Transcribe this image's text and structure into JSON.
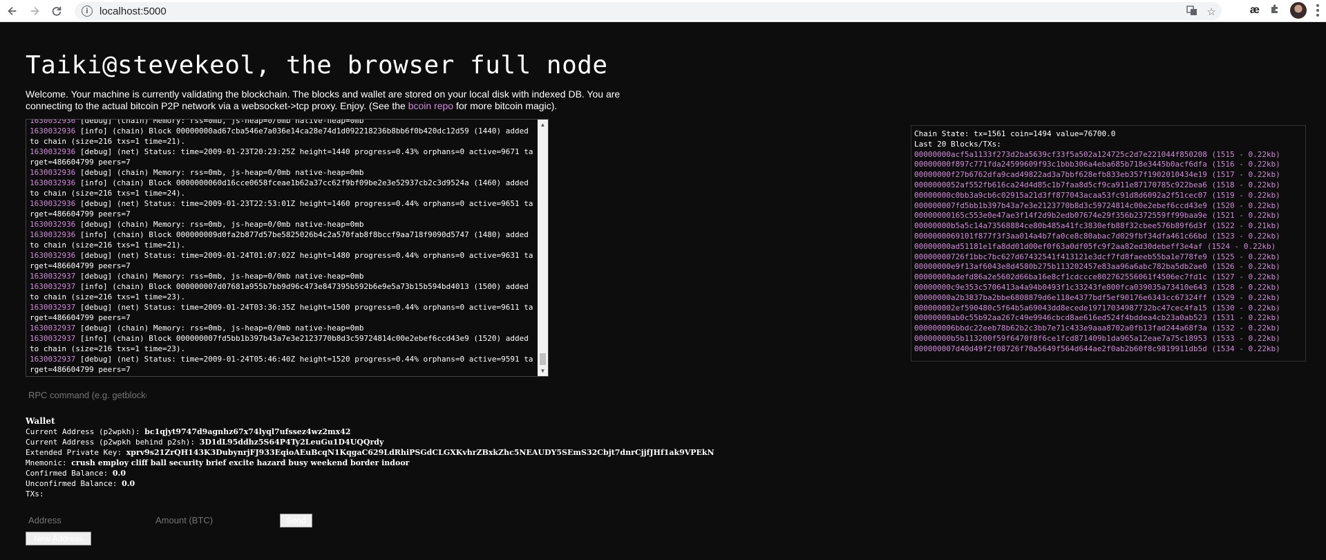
{
  "browser": {
    "url": "localhost:5000",
    "ext_label": "æ"
  },
  "page": {
    "title": "Taiki@stevekeol, the browser full node",
    "intro_before": "Welcome. Your machine is currently validating the blockchain. The blocks and wallet are stored on your local disk with indexed DB. You are connecting to the actual bitcoin P2P network via a websocket->tcp proxy. Enjoy. (See the ",
    "intro_link": "bcoin repo",
    "intro_after": " for more bitcoin magic)."
  },
  "log": [
    {
      "ts": "1630032936",
      "msg": " [debug] (chain) Memory: rss=0mb, js-heap=0/0mb native-heap=0mb"
    },
    {
      "ts": "1630032936",
      "msg": " [info] (chain) Block 00000000ad67cba546e7a036e14ca28e74d1d092218236b8bb6f0b420dc12d59 (1440) added to chain (size=216 txs=1 time=21)."
    },
    {
      "ts": "1630032936",
      "msg": " [debug] (net) Status: time=2009-01-23T20:23:25Z height=1440 progress=0.43% orphans=0 active=9671 target=486604799 peers=7"
    },
    {
      "ts": "1630032936",
      "msg": " [debug] (chain) Memory: rss=0mb, js-heap=0/0mb native-heap=0mb"
    },
    {
      "ts": "1630032936",
      "msg": " [info] (chain) Block 0000000060d16cce0658fceae1b62a37cc62f9bf09be2e3e52937cb2c3d9524a (1460) added to chain (size=216 txs=1 time=24)."
    },
    {
      "ts": "1630032936",
      "msg": " [debug] (net) Status: time=2009-01-23T22:53:01Z height=1460 progress=0.44% orphans=0 active=9651 target=486604799 peers=7"
    },
    {
      "ts": "1630032936",
      "msg": " [debug] (chain) Memory: rss=0mb, js-heap=0/0mb native-heap=0mb"
    },
    {
      "ts": "1630032936",
      "msg": " [info] (chain) Block 000000009d0fa2b877d57be5825026b4c2a570fab8f8bccf9aa718f9090d5747 (1480) added to chain (size=216 txs=1 time=21)."
    },
    {
      "ts": "1630032936",
      "msg": " [debug] (net) Status: time=2009-01-24T01:07:02Z height=1480 progress=0.44% orphans=0 active=9631 target=486604799 peers=7"
    },
    {
      "ts": "1630032937",
      "msg": " [debug] (chain) Memory: rss=0mb, js-heap=0/0mb native-heap=0mb"
    },
    {
      "ts": "1630032937",
      "msg": " [info] (chain) Block 000000007d07681a955b7bb9d96c473e847395b592b6e9e5a73b15b594bd4013 (1500) added to chain (size=216 txs=1 time=23)."
    },
    {
      "ts": "1630032937",
      "msg": " [debug] (net) Status: time=2009-01-24T03:36:35Z height=1500 progress=0.44% orphans=0 active=9611 target=486604799 peers=7"
    },
    {
      "ts": "1630032937",
      "msg": " [debug] (chain) Memory: rss=0mb, js-heap=0/0mb native-heap=0mb"
    },
    {
      "ts": "1630032937",
      "msg": " [info] (chain) Block 000000007fd5bb1b397b43a7e3e2123770b8d3c59724814c00e2ebef6ccd43e9 (1520) added to chain (size=216 txs=1 time=23)."
    },
    {
      "ts": "1630032937",
      "msg": " [debug] (net) Status: time=2009-01-24T05:46:40Z height=1520 progress=0.44% orphans=0 active=9591 target=486604799 peers=7"
    }
  ],
  "rpc": {
    "placeholder": "RPC command (e.g. getblockchaininfo)"
  },
  "wallet": {
    "title": "Wallet",
    "p2wpkh_label": "Current Address (p2wpkh): ",
    "p2wpkh": "bc1qjyt9747d9agnhz67x74lyql7ufssez4wz2mx42",
    "p2sh_label": "Current Address (p2wpkh behind p2sh): ",
    "p2sh": "3D1dL95ddhz5S64P4Ty2LeuGu1D4UQQrdy",
    "xpriv_label": "Extended Private Key: ",
    "xpriv": "xprv9s21ZrQH143K3DubynrjFJ933EqioAEuBcqN1KqgaC629LdRhiPSGdCLGXKvhrZBxkZhc5NEAUDY5SEmS32Cbjt7dnrCjjfJHf1ak9VPEkN",
    "mnemonic_label": "Mnemonic: ",
    "mnemonic": "crush employ cliff ball security brief excite hazard busy weekend border indoor",
    "confirmed_label": "Confirmed Balance: ",
    "confirmed": "0.0",
    "unconfirmed_label": "Unconfirmed Balance: ",
    "unconfirmed": "0.0",
    "txs_label": "TXs:"
  },
  "send": {
    "address_placeholder": "Address",
    "amount_placeholder": "Amount (BTC)",
    "send_label": "Send",
    "new_address_label": "New Address"
  },
  "chain": {
    "state": "Chain State: tx=1561 coin=1494 value=76700.0",
    "last_label": "Last 20 Blocks/TXs:",
    "blocks": [
      {
        "hash": "00000000acf5a1133f273d2ba5639cf33f5a502a124725c2d7e221044f850208",
        "info": " (1515 - 0.22kb)"
      },
      {
        "hash": "00000000f897c771fda24599609f93c1bbb306a4eba685b718e3445b0acf6dfa",
        "info": " (1516 - 0.22kb)"
      },
      {
        "hash": "00000000f27b6762dfa9cad49822ad3a7bbf628efb833eb357f1902010434e19",
        "info": " (1517 - 0.22kb)"
      },
      {
        "hash": "0000000052af552fb616ca24d4d85c1b7faa8d5cf9ca911e87170785c922bea6",
        "info": " (1518 - 0.22kb)"
      },
      {
        "hash": "00000000c0bb3a9cb6c02915a21d3ff877043acaa53fc91d8d6092a2f51cec07",
        "info": " (1519 - 0.22kb)"
      },
      {
        "hash": "000000007fd5bb1b397b43a7e3e2123770b8d3c59724814c00e2ebef6ccd43e9",
        "info": " (1520 - 0.22kb)"
      },
      {
        "hash": "00000000165c553e0e47ae3f14f2d9b2edb07674e29f356b2372559ff99baa9e",
        "info": " (1521 - 0.22kb)"
      },
      {
        "hash": "00000000b5a5c14a73568884ce80b485a41fc3830efb88f32cbee576b89f6d3f",
        "info": " (1522 - 0.21kb)"
      },
      {
        "hash": "0000000069101f877f3f3aa014a4b7fa0ce8c80abac7d029fbf34dfa461c66bd",
        "info": " (1523 - 0.22kb)"
      },
      {
        "hash": "00000000ad51181e1fa8dd01d00ef0f63a0df05fc9f2aa82ed30debeff3e4af",
        "info": " (1524 - 0.22kb)"
      },
      {
        "hash": "00000000726f1bbc7bc627d67432541f413121e3dcf7fd8faeeb55ba1e778fe9",
        "info": " (1525 - 0.22kb)"
      },
      {
        "hash": "00000000e9f13af6043e8d4580b275b113202457e83aa96a6abc782ba5db2ae0",
        "info": " (1526 - 0.22kb)"
      },
      {
        "hash": "00000000adefd86a2e5602d66ba16e8cf1cdccce802762556061f4506ec7fd1c",
        "info": " (1527 - 0.22kb)"
      },
      {
        "hash": "00000000c9e353c5706413a4a94b0493f1c33243fe800fca039035a73410e643",
        "info": " (1528 - 0.22kb)"
      },
      {
        "hash": "00000000a2b3837ba2bbe6808879d6e118e4377bdf5ef90176e6343cc67324ff",
        "info": " (1529 - 0.22kb)"
      },
      {
        "hash": "000000002ef590480c5f64b5a69043dd8ecede19717034987732bc47cec4fa15",
        "info": " (1530 - 0.22kb)"
      },
      {
        "hash": "00000000ab0c55b92aa267c49e9946cbcd8ae616ed524f4bddea4cb23a0ab523",
        "info": " (1531 - 0.22kb)"
      },
      {
        "hash": "000000006bbdc22eeb78b62b2c3bb7e71c433e9aaa8702a0fb13fad244a68f3a",
        "info": " (1532 - 0.22kb)"
      },
      {
        "hash": "00000000b5b113200f59f6470f8f6ce1fcd871409b1da965a12eae7a75c18953",
        "info": " (1533 - 0.22kb)"
      },
      {
        "hash": "000000007d40d49f2f08726f70a5649f564d644ae2f0ab2b60f8c9819911db5d",
        "info": " (1534 - 0.22kb)"
      }
    ]
  }
}
